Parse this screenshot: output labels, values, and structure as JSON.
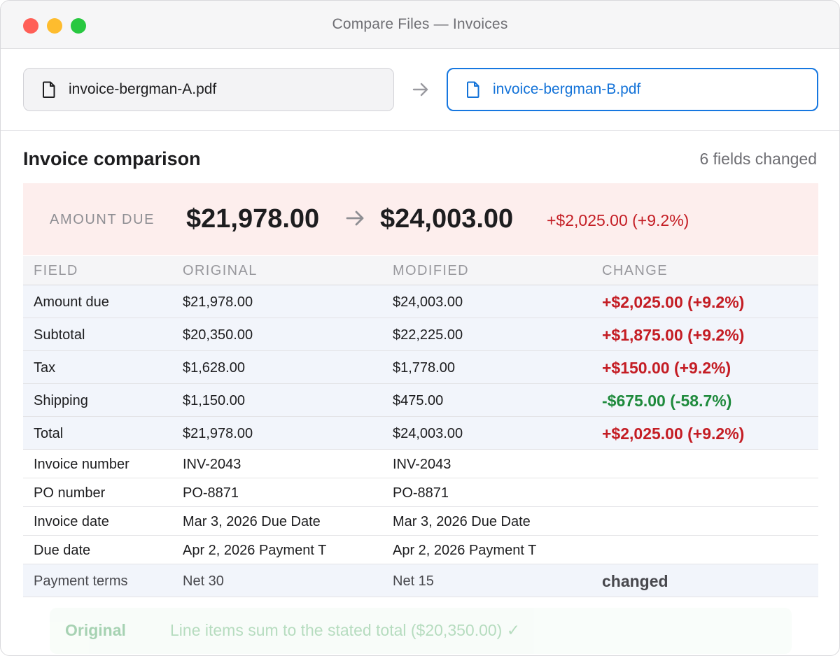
{
  "window": {
    "title": "Compare Files — Invoices"
  },
  "files": {
    "original": "invoice-bergman-A.pdf",
    "modified": "invoice-bergman-B.pdf",
    "file_icon": "document-icon",
    "arrow_icon": "arrow-right-icon"
  },
  "section": {
    "title": "Invoice comparison",
    "fields_changed": "6 fields changed"
  },
  "summary": {
    "label": "AMOUNT DUE",
    "original": "$21,978.00",
    "modified": "$24,003.00",
    "delta": "+$2,025.00 (+9.2%)"
  },
  "table": {
    "headers": [
      "FIELD",
      "ORIGINAL",
      "MODIFIED",
      "CHANGE"
    ],
    "rows": [
      {
        "field": "Amount due",
        "original": "$21,978.00",
        "modified": "$24,003.00",
        "change": "+$2,025.00 (+9.2%)"
      },
      {
        "field": "Subtotal",
        "original": "$20,350.00",
        "modified": "$22,225.00",
        "change": "+$1,875.00 (+9.2%)"
      },
      {
        "field": "Tax",
        "original": "$1,628.00",
        "modified": "$1,778.00",
        "change": "+$150.00 (+9.2%)"
      },
      {
        "field": "Shipping",
        "original": "$1,150.00",
        "modified": "$475.00",
        "change": "-$675.00 (-58.7%)"
      },
      {
        "field": "Total",
        "original": "$21,978.00",
        "modified": "$24,003.00",
        "change": "+$2,025.00 (+9.2%)"
      },
      {
        "field": "Invoice number",
        "original": "INV-2043",
        "modified": "INV-2043",
        "change": ""
      },
      {
        "field": "PO number",
        "original": "PO-8871",
        "modified": "PO-8871",
        "change": ""
      },
      {
        "field": "Invoice date",
        "original": "Mar 3, 2026 Due Date",
        "modified": "Mar 3, 2026 Due Date",
        "change": ""
      },
      {
        "field": "Due date",
        "original": "Apr 2, 2026 Payment T",
        "modified": "Apr 2, 2026 Payment T",
        "change": ""
      },
      {
        "field": "Payment terms",
        "original": "Net 30",
        "modified": "Net 15",
        "change": "changed"
      }
    ]
  },
  "footer": {
    "label": "Original",
    "text": "Line items sum to the stated total ($20,350.00) ✓"
  },
  "colors": {
    "increase": "#c41d24",
    "decrease": "#1e8a3c",
    "accent": "#1677e0",
    "summary_bg": "#fdeeed",
    "changed_row_bg": "#f2f5fb"
  }
}
